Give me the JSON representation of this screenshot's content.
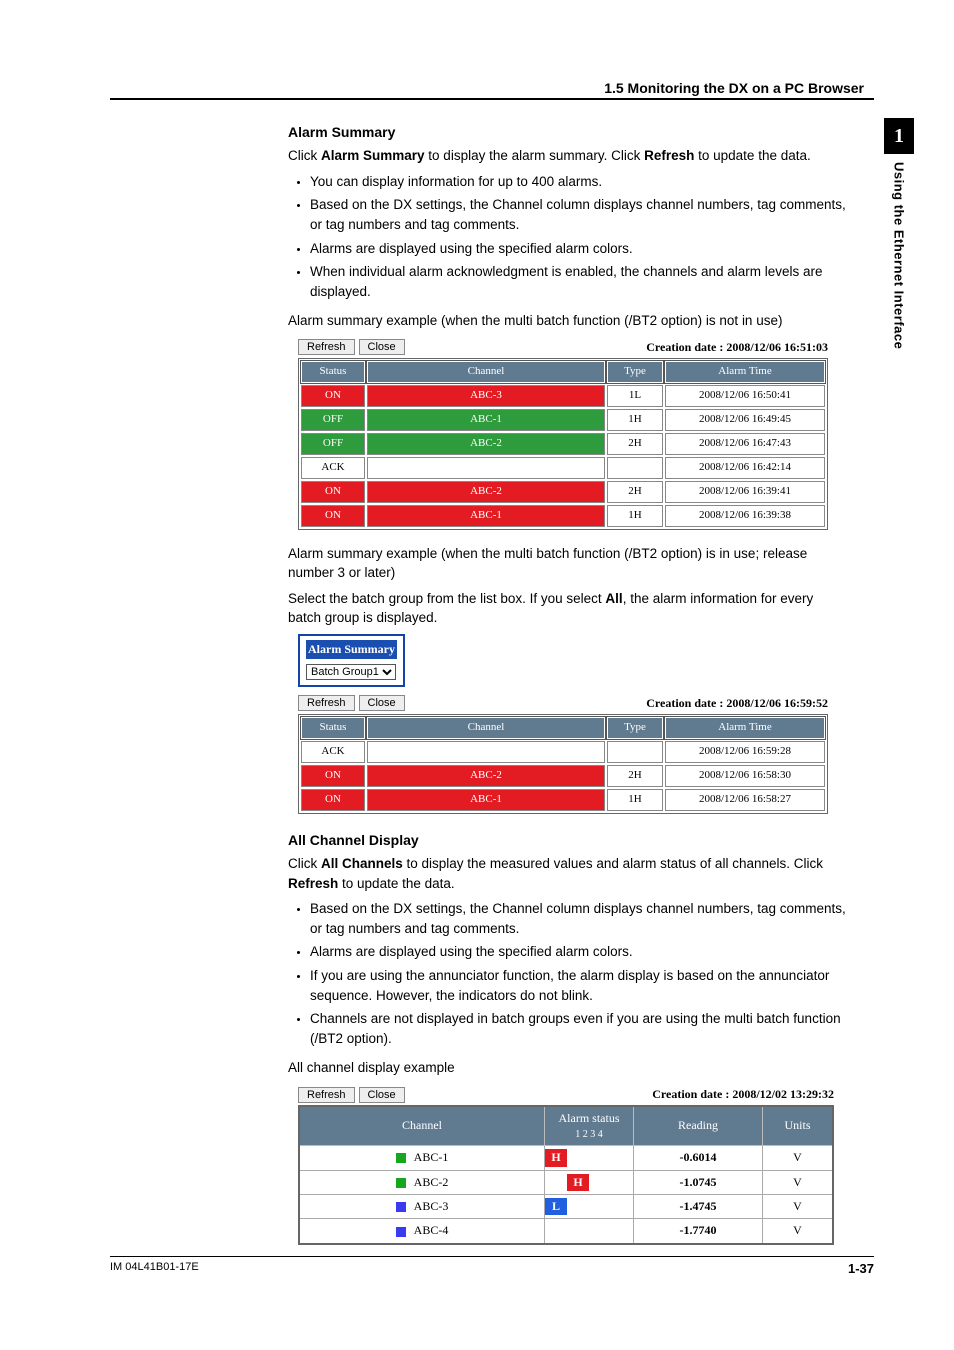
{
  "header": {
    "section": "1.5  Monitoring the DX on a PC Browser"
  },
  "side": {
    "chapter_num": "1",
    "chapter_title": "Using the Ethernet Interface"
  },
  "alarm_summary": {
    "heading": "Alarm Summary",
    "intro_a": "Click ",
    "intro_b": "Alarm Summary",
    "intro_c": " to display the alarm summary. Click ",
    "intro_d": "Refresh",
    "intro_e": " to update the data.",
    "bullets": [
      "You can display information for up to 400 alarms.",
      "Based on the DX settings, the Channel column displays channel numbers, tag comments, or tag numbers and tag comments.",
      "Alarms are displayed using the specified alarm colors.",
      "When individual alarm acknowledgment is enabled, the channels and alarm levels are displayed."
    ],
    "example1_caption": "Alarm summary example (when the multi batch function (/BT2 option) is not in use)",
    "btn_refresh": "Refresh",
    "btn_close": "Close",
    "creation1": "Creation date : 2008/12/06 16:51:03",
    "cols": {
      "status": "Status",
      "channel": "Channel",
      "type": "Type",
      "time": "Alarm Time"
    },
    "rows1": [
      {
        "cls": "row-red",
        "status": "ON",
        "channel": "ABC-3",
        "type": "1L",
        "time": "2008/12/06 16:50:41"
      },
      {
        "cls": "row-green",
        "status": "OFF",
        "channel": "ABC-1",
        "type": "1H",
        "time": "2008/12/06 16:49:45"
      },
      {
        "cls": "row-green",
        "status": "OFF",
        "channel": "ABC-2",
        "type": "2H",
        "time": "2008/12/06 16:47:43"
      },
      {
        "cls": "row-plain",
        "status": "ACK",
        "channel": "",
        "type": "",
        "time": "2008/12/06 16:42:14"
      },
      {
        "cls": "row-red",
        "status": "ON",
        "channel": "ABC-2",
        "type": "2H",
        "time": "2008/12/06 16:39:41"
      },
      {
        "cls": "row-red",
        "status": "ON",
        "channel": "ABC-1",
        "type": "1H",
        "time": "2008/12/06 16:39:38"
      }
    ],
    "example2_caption": "Alarm summary example (when the multi batch function (/BT2 option) is in use; release number 3 or later)",
    "example2_text_a": "Select the batch group from the list box. If you select ",
    "example2_text_b": "All",
    "example2_text_c": ", the alarm information for every batch group is displayed.",
    "selector_title": "Alarm Summary",
    "selector_value": "Batch Group1",
    "creation2": "Creation date : 2008/12/06 16:59:52",
    "rows2": [
      {
        "cls": "row-plain",
        "status": "ACK",
        "channel": "",
        "type": "",
        "time": "2008/12/06 16:59:28"
      },
      {
        "cls": "row-red",
        "status": "ON",
        "channel": "ABC-2",
        "type": "2H",
        "time": "2008/12/06 16:58:30"
      },
      {
        "cls": "row-red",
        "status": "ON",
        "channel": "ABC-1",
        "type": "1H",
        "time": "2008/12/06 16:58:27"
      }
    ]
  },
  "all_channel": {
    "heading": "All Channel Display",
    "intro_a": "Click ",
    "intro_b": "All Channels",
    "intro_c": " to display the measured values and alarm status of all channels. Click ",
    "intro_d": "Refresh",
    "intro_e": " to update the data.",
    "bullets": [
      "Based on the DX settings, the Channel column displays channel numbers, tag comments, or tag numbers and tag comments.",
      "Alarms are displayed using the specified alarm colors.",
      "If you are using the annunciator function, the alarm display is based on the annunciator sequence. However, the indicators do not blink.",
      "Channels are not displayed in batch groups even if you are using the multi batch function (/BT2 option)."
    ],
    "example_caption": "All channel display example",
    "creation": "Creation date : 2008/12/02 13:29:32",
    "cols": {
      "channel": "Channel",
      "alarm": "Alarm status",
      "alarm_sub": "1   2   3   4",
      "reading": "Reading",
      "units": "Units"
    },
    "rows": [
      {
        "color": "#19a61f",
        "name": "ABC-1",
        "alarm_col": 0,
        "alarm_lbl": "H",
        "reading": "-0.6014",
        "units": "V"
      },
      {
        "color": "#19a61f",
        "name": "ABC-2",
        "alarm_col": 1,
        "alarm_lbl": "H",
        "reading": "-1.0745",
        "units": "V"
      },
      {
        "color": "#3a3af0",
        "name": "ABC-3",
        "alarm_col": 0,
        "alarm_lbl": "L",
        "reading": "-1.4745",
        "units": "V"
      },
      {
        "color": "#3a3af0",
        "name": "ABC-4",
        "alarm_col": -1,
        "alarm_lbl": "",
        "reading": "-1.7740",
        "units": "V"
      }
    ]
  },
  "footer": {
    "left": "IM 04L41B01-17E",
    "right": "1-37"
  }
}
